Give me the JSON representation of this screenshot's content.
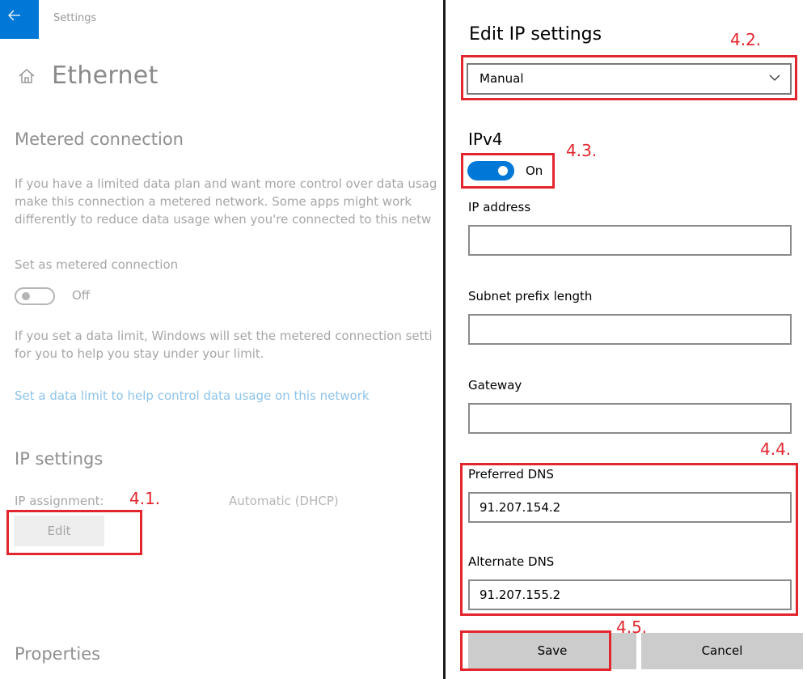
{
  "background": {
    "app_title": "Settings",
    "page_title": "Ethernet",
    "metered": {
      "title": "Metered connection",
      "desc_lines": [
        "If you have a limited data plan and want more control over data usag",
        "make this connection a metered network. Some apps might work",
        "differently to reduce data usage when you're connected to this netw"
      ],
      "toggle_label": "Set as metered connection",
      "toggle_state": "Off",
      "limit_lines": [
        "If you set a data limit, Windows will set the metered connection setti",
        "for you to help you stay under your limit."
      ],
      "link": "Set a data limit to help control data usage on this network"
    },
    "ip_settings": {
      "title": "IP settings",
      "assignment_label": "IP assignment:",
      "assignment_value": "Automatic (DHCP)",
      "edit_button": "Edit"
    },
    "properties_title": "Properties"
  },
  "panel": {
    "title": "Edit IP settings",
    "mode_selected": "Manual",
    "ipv4_title": "IPv4",
    "ipv4_toggle_state": "On",
    "fields": {
      "ip_address": {
        "label": "IP address",
        "value": ""
      },
      "subnet": {
        "label": "Subnet prefix length",
        "value": ""
      },
      "gateway": {
        "label": "Gateway",
        "value": ""
      },
      "preferred_dns": {
        "label": "Preferred DNS",
        "value": "91.207.154.2"
      },
      "alternate_dns": {
        "label": "Alternate DNS",
        "value": "91.207.155.2"
      }
    },
    "save_button": "Save",
    "cancel_button": "Cancel"
  },
  "annotations": {
    "step_1": "4.1.",
    "step_2": "4.2.",
    "step_3": "4.3.",
    "step_4": "4.4.",
    "step_5": "4.5."
  },
  "colors": {
    "accent": "#0078d7",
    "annotation_red": "#e3262d",
    "link_blue": "#8ec4ea"
  }
}
